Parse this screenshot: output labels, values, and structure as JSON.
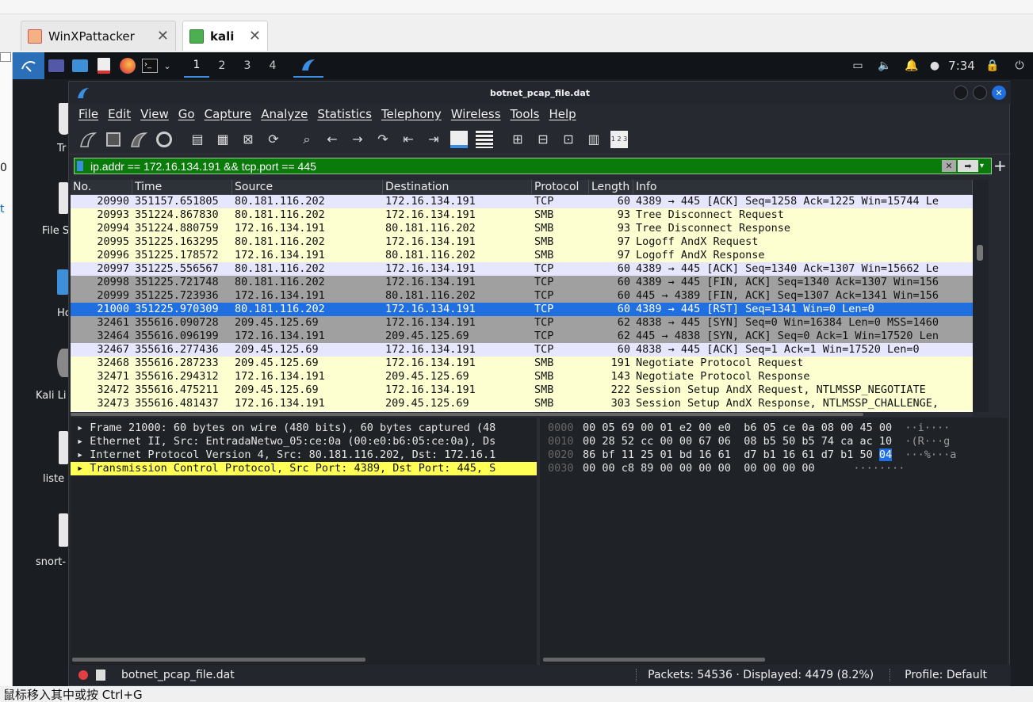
{
  "host": {
    "tabs": [
      {
        "label": "WinXPattacker"
      },
      {
        "label": "kali"
      }
    ],
    "left_strip_text": [
      "0",
      "t"
    ],
    "ime_text": "鼠标移入其中或按 Ctrl+G"
  },
  "kali_panel": {
    "workspaces": [
      "1",
      "2",
      "3",
      "4"
    ],
    "clock": "7:34"
  },
  "desktop_icons": [
    "Tr",
    "File S",
    "Ho",
    "Kali Li",
    "liste",
    "snort-"
  ],
  "window": {
    "title": "botnet_pcap_file.dat",
    "menu": [
      "File",
      "Edit",
      "View",
      "Go",
      "Capture",
      "Analyze",
      "Statistics",
      "Telephony",
      "Wireless",
      "Tools",
      "Help"
    ],
    "filter": "ip.addr == 172.16.134.191 && tcp.port == 445",
    "columns": [
      "No.",
      "Time",
      "Source",
      "Destination",
      "Protocol",
      "Length",
      "Info"
    ],
    "packets": [
      {
        "no": "20990",
        "time": "351157.651805",
        "src": "80.181.116.202",
        "dst": "172.16.134.191",
        "proto": "TCP",
        "len": "60",
        "info": "4389 → 445 [ACK] Seq=1258 Ack=1225 Win=15744 Le",
        "bg": "#e7e6ff"
      },
      {
        "no": "20993",
        "time": "351224.867830",
        "src": "80.181.116.202",
        "dst": "172.16.134.191",
        "proto": "SMB",
        "len": "93",
        "info": "Tree Disconnect Request",
        "bg": "#feffd0"
      },
      {
        "no": "20994",
        "time": "351224.880759",
        "src": "172.16.134.191",
        "dst": "80.181.116.202",
        "proto": "SMB",
        "len": "93",
        "info": "Tree Disconnect Response",
        "bg": "#feffd0"
      },
      {
        "no": "20995",
        "time": "351225.163295",
        "src": "80.181.116.202",
        "dst": "172.16.134.191",
        "proto": "SMB",
        "len": "97",
        "info": "Logoff AndX Request",
        "bg": "#feffd0"
      },
      {
        "no": "20996",
        "time": "351225.178572",
        "src": "172.16.134.191",
        "dst": "80.181.116.202",
        "proto": "SMB",
        "len": "97",
        "info": "Logoff AndX Response",
        "bg": "#feffd0"
      },
      {
        "no": "20997",
        "time": "351225.556567",
        "src": "80.181.116.202",
        "dst": "172.16.134.191",
        "proto": "TCP",
        "len": "60",
        "info": "4389 → 445 [ACK] Seq=1340 Ack=1307 Win=15662 Le",
        "bg": "#e7e6ff"
      },
      {
        "no": "20998",
        "time": "351225.721748",
        "src": "80.181.116.202",
        "dst": "172.16.134.191",
        "proto": "TCP",
        "len": "60",
        "info": "4389 → 445 [FIN, ACK] Seq=1340 Ack=1307 Win=156",
        "bg": "#a0a0a0"
      },
      {
        "no": "20999",
        "time": "351225.723936",
        "src": "172.16.134.191",
        "dst": "80.181.116.202",
        "proto": "TCP",
        "len": "60",
        "info": "445 → 4389 [FIN, ACK] Seq=1307 Ack=1341 Win=156",
        "bg": "#a0a0a0"
      },
      {
        "no": "21000",
        "time": "351225.970309",
        "src": "80.181.116.202",
        "dst": "172.16.134.191",
        "proto": "TCP",
        "len": "60",
        "info": "4389 → 445 [RST] Seq=1341 Win=0 Len=0",
        "bg": "#1f6fe0",
        "fg": "#ffffff"
      },
      {
        "no": "32461",
        "time": "355616.090728",
        "src": "209.45.125.69",
        "dst": "172.16.134.191",
        "proto": "TCP",
        "len": "62",
        "info": "4838 → 445 [SYN] Seq=0 Win=16384 Len=0 MSS=1460",
        "bg": "#a0a0a0"
      },
      {
        "no": "32464",
        "time": "355616.096199",
        "src": "172.16.134.191",
        "dst": "209.45.125.69",
        "proto": "TCP",
        "len": "62",
        "info": "445 → 4838 [SYN, ACK] Seq=0 Ack=1 Win=17520 Len",
        "bg": "#a0a0a0"
      },
      {
        "no": "32467",
        "time": "355616.277436",
        "src": "209.45.125.69",
        "dst": "172.16.134.191",
        "proto": "TCP",
        "len": "60",
        "info": "4838 → 445 [ACK] Seq=1 Ack=1 Win=17520 Len=0",
        "bg": "#e7e6ff"
      },
      {
        "no": "32468",
        "time": "355616.287233",
        "src": "209.45.125.69",
        "dst": "172.16.134.191",
        "proto": "SMB",
        "len": "191",
        "info": "Negotiate Protocol Request",
        "bg": "#feffd0"
      },
      {
        "no": "32471",
        "time": "355616.294312",
        "src": "172.16.134.191",
        "dst": "209.45.125.69",
        "proto": "SMB",
        "len": "143",
        "info": "Negotiate Protocol Response",
        "bg": "#feffd0"
      },
      {
        "no": "32472",
        "time": "355616.475211",
        "src": "209.45.125.69",
        "dst": "172.16.134.191",
        "proto": "SMB",
        "len": "222",
        "info": "Session Setup AndX Request, NTLMSSP_NEGOTIATE",
        "bg": "#feffd0"
      },
      {
        "no": "32473",
        "time": "355616.481437",
        "src": "172.16.134.191",
        "dst": "209.45.125.69",
        "proto": "SMB",
        "len": "303",
        "info": "Session Setup AndX Response, NTLMSSP_CHALLENGE,",
        "bg": "#feffd0"
      }
    ],
    "details": [
      {
        "text": "▸ Frame 21000: 60 bytes on wire (480 bits), 60 bytes captured (48",
        "hl": false
      },
      {
        "text": "▸ Ethernet II, Src: EntradaNetwo_05:ce:0a (00:e0:b6:05:ce:0a), Ds",
        "hl": false
      },
      {
        "text": "▸ Internet Protocol Version 4, Src: 80.181.116.202, Dst: 172.16.1",
        "hl": false
      },
      {
        "text": "▸ Transmission Control Protocol, Src Port: 4389, Dst Port: 445, S",
        "hl": true
      }
    ],
    "bytes": [
      {
        "off": "0000",
        "hex": "00 05 69 00 01 e2 00 e0  b6 05 ce 0a 08 00 45 00",
        "sel": "",
        "asc": "  ··i····"
      },
      {
        "off": "0010",
        "hex": "00 28 52 cc 00 00 67 06  08 b5 50 b5 74 ca ac 10",
        "sel": "",
        "asc": "  ·(R···g"
      },
      {
        "off": "0020",
        "hex": "86 bf 11 25 01 bd 16 61  d7 b1 16 61 d7 b1 50 ",
        "sel": "04",
        "asc": "  ···%···a"
      },
      {
        "off": "0030",
        "hex": "00 00 c8 89 00 00 00 00  00 00 00 00",
        "sel": "",
        "asc": "      ········"
      }
    ],
    "status": {
      "file": "botnet_pcap_file.dat",
      "packets": "Packets: 54536 · Displayed: 4479 (8.2%)",
      "profile": "Profile: Default"
    }
  }
}
